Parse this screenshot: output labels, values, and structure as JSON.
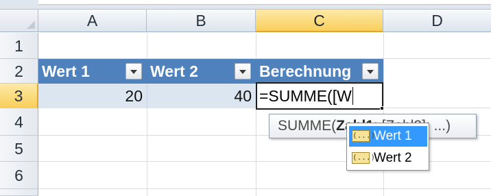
{
  "columns": [
    "A",
    "B",
    "C",
    "D"
  ],
  "active_column": "C",
  "rows": [
    "1",
    "2",
    "3",
    "4",
    "5",
    "6"
  ],
  "active_row": "3",
  "table": {
    "headers": [
      "Wert 1",
      "Wert 2",
      "Berechnung"
    ],
    "header_color": "#4f81bd",
    "row_band_color": "#dce6f1",
    "values": [
      "20",
      "40"
    ],
    "formula": "=SUMME([W"
  },
  "tooltip": {
    "prefix": "SUMME(",
    "bold": "Zahl1",
    "suffix": "; [Zahl2]; ...)"
  },
  "autocomplete": {
    "items": [
      {
        "label": "Wert 1",
        "icon": "table-column-icon",
        "selected": true
      },
      {
        "label": "Wert 2",
        "icon": "table-column-icon",
        "selected": false
      }
    ],
    "icon_glyph": "(...)",
    "selection_color": "#3399ff"
  }
}
